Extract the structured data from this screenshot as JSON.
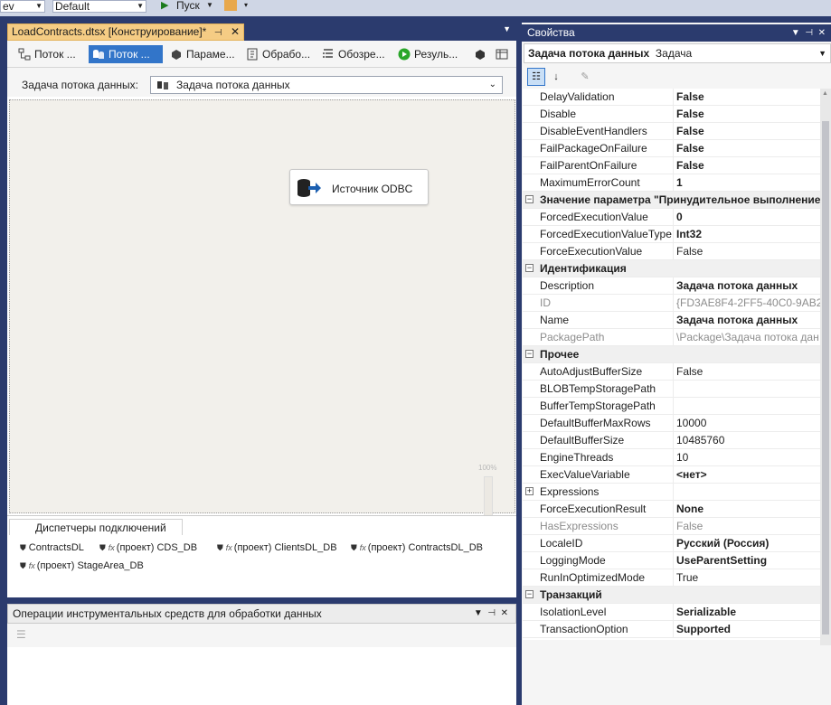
{
  "toolbar": {
    "config_value": "ev",
    "platform_value": "Default",
    "start_label": "Пуск"
  },
  "document": {
    "tab_title": "LoadContracts.dtsx [Конструирование]*",
    "tabs": [
      {
        "label": "Поток ...",
        "icon": "control-flow-icon"
      },
      {
        "label": "Поток ...",
        "icon": "data-flow-icon"
      },
      {
        "label": "Параме...",
        "icon": "parameters-icon"
      },
      {
        "label": "Обрабо...",
        "icon": "event-handlers-icon"
      },
      {
        "label": "Обозре...",
        "icon": "package-explorer-icon"
      },
      {
        "label": "Резуль...",
        "icon": "progress-icon"
      }
    ],
    "task_label": "Задача потока данных:",
    "task_value": "Задача потока данных",
    "component_label": "Источник ODBC",
    "zoom_label": "100%"
  },
  "connection_managers": {
    "title": "Диспетчеры подключений",
    "items": [
      {
        "label": "ContractsDL",
        "project": false
      },
      {
        "label": "(проект) CDS_DB",
        "project": true
      },
      {
        "label": "(проект) ClientsDL_DB",
        "project": true
      },
      {
        "label": "(проект) ContractsDL_DB",
        "project": true
      },
      {
        "label": "(проект) StageArea_DB",
        "project": true
      }
    ]
  },
  "operations": {
    "title": "Операции инструментальных средств для обработки данных"
  },
  "properties": {
    "title": "Свойства",
    "object_name": "Задача потока данных",
    "object_type": "Задача",
    "rows": [
      {
        "type": "prop",
        "name": "DelayValidation",
        "value": "False",
        "bold": true
      },
      {
        "type": "prop",
        "name": "Disable",
        "value": "False",
        "bold": true
      },
      {
        "type": "prop",
        "name": "DisableEventHandlers",
        "value": "False",
        "bold": true
      },
      {
        "type": "prop",
        "name": "FailPackageOnFailure",
        "value": "False",
        "bold": true
      },
      {
        "type": "prop",
        "name": "FailParentOnFailure",
        "value": "False",
        "bold": true
      },
      {
        "type": "prop",
        "name": "MaximumErrorCount",
        "value": "1",
        "bold": true
      },
      {
        "type": "cat",
        "name": "Значение параметра \"Принудительное выполнение\"",
        "expanded": true
      },
      {
        "type": "prop",
        "name": "ForcedExecutionValue",
        "value": "0",
        "bold": true
      },
      {
        "type": "prop",
        "name": "ForcedExecutionValueType",
        "value": "Int32",
        "bold": true
      },
      {
        "type": "prop",
        "name": "ForceExecutionValue",
        "value": "False",
        "bold": false
      },
      {
        "type": "cat",
        "name": "Идентификация",
        "expanded": true
      },
      {
        "type": "prop",
        "name": "Description",
        "value": "Задача потока данных",
        "bold": true
      },
      {
        "type": "prop",
        "name": "ID",
        "value": "{FD3AE8F4-2FF5-40C0-9AB2-(",
        "bold": false,
        "disabled": true
      },
      {
        "type": "prop",
        "name": "Name",
        "value": "Задача потока данных",
        "bold": true
      },
      {
        "type": "prop",
        "name": "PackagePath",
        "value": "\\Package\\Задача потока дан",
        "bold": false,
        "disabled": true
      },
      {
        "type": "cat",
        "name": "Прочее",
        "expanded": true
      },
      {
        "type": "prop",
        "name": "AutoAdjustBufferSize",
        "value": "False",
        "bold": false
      },
      {
        "type": "prop",
        "name": "BLOBTempStoragePath",
        "value": "",
        "bold": false
      },
      {
        "type": "prop",
        "name": "BufferTempStoragePath",
        "value": "",
        "bold": false
      },
      {
        "type": "prop",
        "name": "DefaultBufferMaxRows",
        "value": "10000",
        "bold": false
      },
      {
        "type": "prop",
        "name": "DefaultBufferSize",
        "value": "10485760",
        "bold": false
      },
      {
        "type": "prop",
        "name": "EngineThreads",
        "value": "10",
        "bold": false
      },
      {
        "type": "prop",
        "name": "ExecValueVariable",
        "value": "<нет>",
        "bold": true
      },
      {
        "type": "prop",
        "name": "Expressions",
        "value": "",
        "bold": false,
        "expandable": true
      },
      {
        "type": "prop",
        "name": "ForceExecutionResult",
        "value": "None",
        "bold": true
      },
      {
        "type": "prop",
        "name": "HasExpressions",
        "value": "False",
        "bold": false,
        "disabled": true
      },
      {
        "type": "prop",
        "name": "LocaleID",
        "value": "Русский (Россия)",
        "bold": true
      },
      {
        "type": "prop",
        "name": "LoggingMode",
        "value": "UseParentSetting",
        "bold": true
      },
      {
        "type": "prop",
        "name": "RunInOptimizedMode",
        "value": "True",
        "bold": false
      },
      {
        "type": "cat",
        "name": "Транзакций",
        "expanded": true
      },
      {
        "type": "prop",
        "name": "IsolationLevel",
        "value": "Serializable",
        "bold": true
      },
      {
        "type": "prop",
        "name": "TransactionOption",
        "value": "Supported",
        "bold": true
      }
    ]
  },
  "colors": {
    "frame": "#2b3b6e",
    "active_tab": "#f5cc84",
    "selected_tab": "#3275c9",
    "canvas": "#f2f0eb"
  }
}
